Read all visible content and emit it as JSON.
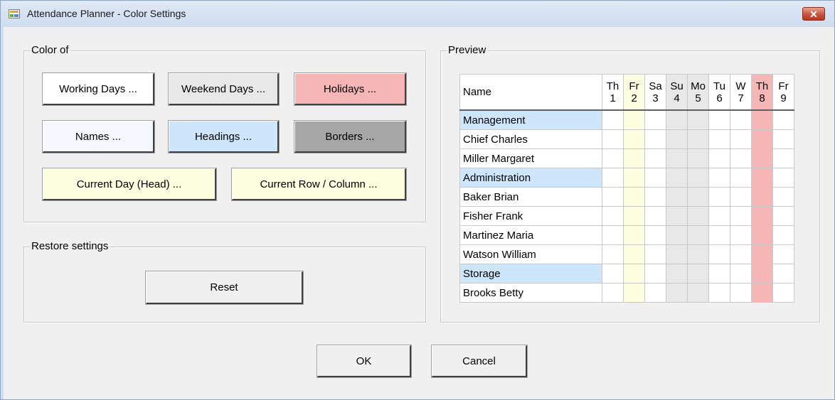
{
  "window": {
    "title": "Attendance Planner - Color Settings",
    "close_glyph": "✕"
  },
  "color_group": {
    "legend": "Color of",
    "buttons": [
      {
        "label": "Working Days ..."
      },
      {
        "label": "Weekend Days ..."
      },
      {
        "label": "Holidays ..."
      },
      {
        "label": "Names ..."
      },
      {
        "label": "Headings ..."
      },
      {
        "label": "Borders ..."
      },
      {
        "label": "Current Day (Head) ..."
      },
      {
        "label": "Current Row / Column ..."
      }
    ]
  },
  "restore_group": {
    "legend": "Restore settings",
    "reset_label": "Reset"
  },
  "preview_group": {
    "legend": "Preview",
    "name_header": "Name",
    "days": [
      {
        "dow": "Th",
        "num": "1",
        "kind": "white"
      },
      {
        "dow": "Fr",
        "num": "2",
        "kind": "cur"
      },
      {
        "dow": "Sa",
        "num": "3",
        "kind": "white"
      },
      {
        "dow": "Su",
        "num": "4",
        "kind": "wk"
      },
      {
        "dow": "Mo",
        "num": "5",
        "kind": "wk"
      },
      {
        "dow": "Tu",
        "num": "6",
        "kind": "white"
      },
      {
        "dow": "W",
        "num": "7",
        "kind": "white"
      },
      {
        "dow": "Th",
        "num": "8",
        "kind": "hol"
      },
      {
        "dow": "Fr",
        "num": "9",
        "kind": "white"
      }
    ],
    "rows": [
      {
        "name": "Management",
        "type": "dept"
      },
      {
        "name": "Chief Charles",
        "type": "person"
      },
      {
        "name": "Miller Margaret",
        "type": "person"
      },
      {
        "name": "Administration",
        "type": "dept"
      },
      {
        "name": "Baker Brian",
        "type": "person"
      },
      {
        "name": "Fisher Frank",
        "type": "person"
      },
      {
        "name": "Martinez Maria",
        "type": "person"
      },
      {
        "name": "Watson William",
        "type": "person"
      },
      {
        "name": "Storage",
        "type": "dept"
      },
      {
        "name": "Brooks Betty",
        "type": "person"
      }
    ]
  },
  "dialog_buttons": {
    "ok_label": "OK",
    "cancel_label": "Cancel"
  },
  "colors": {
    "working_days": "#ffffff",
    "weekend_days": "#e8e8e8",
    "holidays": "#f7b6b6",
    "names": "#f5f8ff",
    "headings": "#cde6fb",
    "borders": "#a6a6a6",
    "current_day": "#fdfde0",
    "current_row_column": "#fdfde0"
  }
}
